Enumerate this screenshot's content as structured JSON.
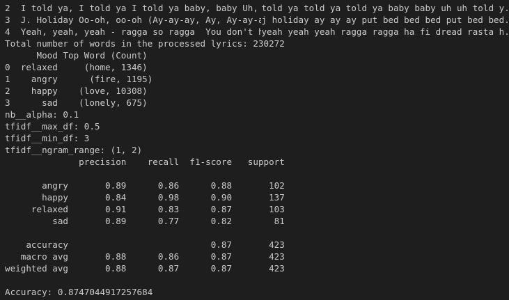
{
  "lyrics_rows": [
    {
      "lead": "2  I told ya, I told ya I told ya baby, baby Uh, ...",
      "trail": "told ya told ya told ya baby baby uh uh told y..."
    },
    {
      "lead": "3  J. Holiday Oo-oh, oo-oh (Ay-ay-ay, Ay, Ay-ay-a...",
      "trail": "j holiday ay ay ay put bed bed bed put bed bed..."
    },
    {
      "lead": "4  Yeah, yeah, yeah - ragga so ragga  You don't h...",
      "trail": "yeah yeah yeah ragga ragga ha fi dread rasta h..."
    }
  ],
  "total_words_line": "Total number of words in the processed lyrics: 230272",
  "mood_table": {
    "header": "      Mood Top Word (Count)",
    "rows": [
      "0  relaxed     (home, 1346)",
      "1    angry      (fire, 1195)",
      "2    happy    (love, 10308)",
      "3      sad    (lonely, 675)"
    ]
  },
  "params": [
    "nb__alpha: 0.1",
    "tfidf__max_df: 0.5",
    "tfidf__min_df: 3",
    "tfidf__ngram_range: (1, 2)"
  ],
  "report": {
    "header": "              precision    recall  f1-score   support",
    "class_rows": [
      "       angry       0.89      0.86      0.88       102",
      "       happy       0.84      0.98      0.90       137",
      "     relaxed       0.91      0.83      0.87       103",
      "         sad       0.89      0.77      0.82        81"
    ],
    "summary_rows": [
      "    accuracy                           0.87       423",
      "   macro avg       0.88      0.86      0.87       423",
      "weighted avg       0.88      0.87      0.87       423"
    ]
  },
  "accuracy_line": "Accuracy: 0.8747044917257684",
  "colors": {
    "background": "#1e1e1e",
    "text": "#cccccc"
  }
}
